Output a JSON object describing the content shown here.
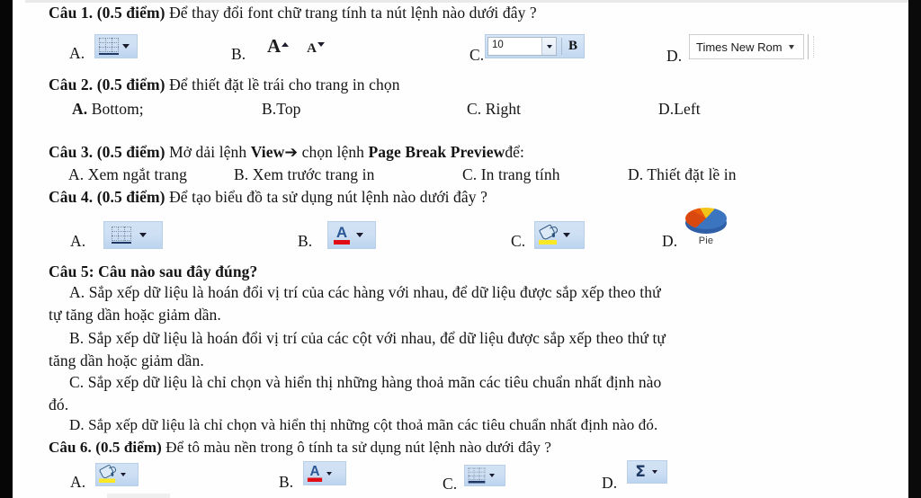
{
  "document": {
    "type": "scanned-exam-paper",
    "language": "vi",
    "questions": [
      {
        "id": "cau1",
        "number": "Câu 1.",
        "points": "(0.5 điểm)",
        "text": "Để  thay đổi font chữ trang tính ta nút lệnh nào dưới đây ?",
        "options": [
          {
            "key": "A.",
            "icon": "borders-icon"
          },
          {
            "key": "B.",
            "icon": "increase-decrease-font-size-icon",
            "glyph_big": "A",
            "glyph_small": "A"
          },
          {
            "key": "C.",
            "icon": "font-size-combo-icon",
            "value": "10",
            "bold_label": "B"
          },
          {
            "key": "D.",
            "icon": "font-name-combo-icon",
            "value": "Times New Rom"
          }
        ]
      },
      {
        "id": "cau2",
        "number": "Câu 2.",
        "points": "(0.5 điểm)",
        "text": "Để thiết đặt lề trái cho trang in chọn",
        "options": [
          {
            "key": "A.",
            "label": "Bottom;"
          },
          {
            "key": "B.",
            "label": "Top"
          },
          {
            "key": "C.",
            "label": "Right"
          },
          {
            "key": "D.",
            "label": "Left"
          }
        ]
      },
      {
        "id": "cau3",
        "number": "Câu 3.",
        "points": "(0.5 điểm)",
        "text_pre": "Mở dải lệnh ",
        "bold1": "View",
        "arrow": "➔",
        "text_mid": " chọn lệnh ",
        "bold2": "Page Break Preview",
        "text_post": "để:",
        "options": [
          {
            "key": "A.",
            "label": "Xem ngắt trang"
          },
          {
            "key": "B.",
            "label": "Xem trước trang in"
          },
          {
            "key": "C.",
            "label": "In trang tính"
          },
          {
            "key": "D.",
            "label": "Thiết đặt lề in"
          }
        ]
      },
      {
        "id": "cau4",
        "number": "Câu 4.",
        "points": "(0.5 điểm)",
        "text": "Để tạo biểu đồ ta sử dụng nút lệnh nào dưới đây ?",
        "options": [
          {
            "key": "A.",
            "icon": "borders-icon"
          },
          {
            "key": "B.",
            "icon": "font-color-icon",
            "glyph": "A"
          },
          {
            "key": "C.",
            "icon": "fill-color-icon"
          },
          {
            "key": "D.",
            "icon": "pie-chart-icon",
            "label": "Pie"
          }
        ]
      },
      {
        "id": "cau5",
        "number": "Câu 5:",
        "text": "Câu nào sau đây đúng?",
        "options": [
          {
            "key": "A.",
            "line1": "Sắp xếp dữ liệu là hoán đổi vị trí của các hàng với nhau, để dữ liệu được sắp xếp theo thứ",
            "line2": "tự tăng dần hoặc giảm dần."
          },
          {
            "key": "B.",
            "line1": "Sắp xếp dữ liệu là hoán đổi vị trí của các cột với nhau, để dữ liệu được sắp xếp theo thứ tự",
            "line2": "tăng dần hoặc giảm dần."
          },
          {
            "key": "C.",
            "line1": "Sắp xếp dữ liệu là chỉ chọn và hiển thị những hàng thoả mãn các tiêu chuẩn nhất định nào",
            "line2": "đó."
          },
          {
            "key": "D.",
            "line1": "Sắp xếp dữ liệu là chỉ chọn và hiển thị những cột thoả mãn các tiêu chuẩn nhất định nào đó.",
            "line2": ""
          }
        ]
      },
      {
        "id": "cau6",
        "number": "Câu 6.",
        "points": "(0.5 điểm)",
        "text": "Để tô màu nền trong ô tính ta sử dụng nút lệnh nào dưới đây ?",
        "options": [
          {
            "key": "A.",
            "icon": "fill-color-icon"
          },
          {
            "key": "B.",
            "icon": "font-color-icon",
            "glyph": "A"
          },
          {
            "key": "C.",
            "icon": "borders-icon"
          },
          {
            "key": "D.",
            "icon": "autosum-icon",
            "glyph": "Σ"
          }
        ]
      }
    ]
  },
  "colors": {
    "paper": "#fefefe",
    "ink": "#141414",
    "ribbon_blue": "#cfe0f4",
    "font_color_red": "#e00d16",
    "fill_yellow": "#fbe825",
    "excel_blue": "#2b5797",
    "pie_blue": "#3b74bf",
    "pie_orange": "#d9480f",
    "pie_yellow": "#f0c419"
  }
}
